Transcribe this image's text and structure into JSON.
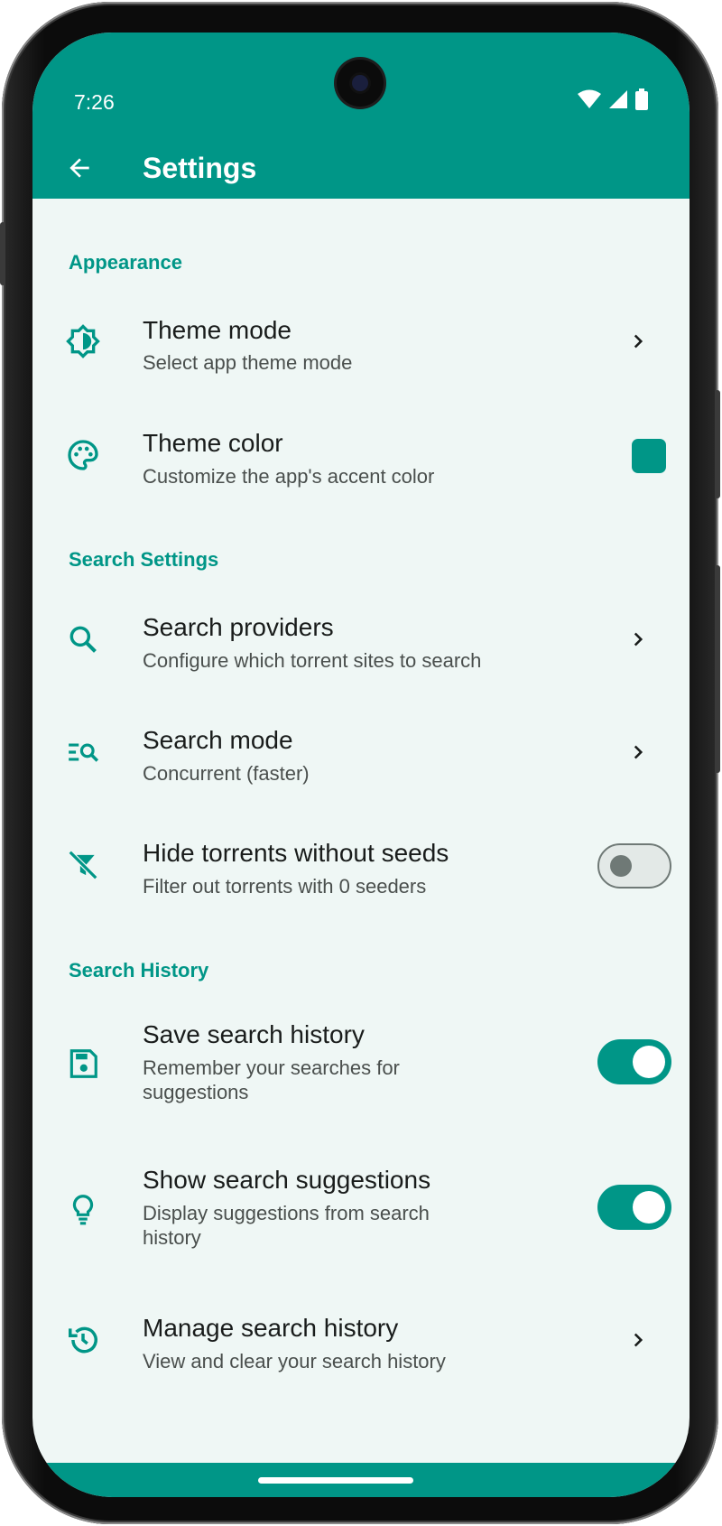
{
  "status_bar": {
    "time": "7:26"
  },
  "header": {
    "title": "Settings"
  },
  "colors": {
    "accent": "#009687",
    "background": "#eff7f5",
    "title_text": "#191c1b",
    "subtitle_text": "#4a4f4d"
  },
  "sections": {
    "appearance": {
      "label": "Appearance",
      "theme_mode": {
        "icon": "brightness-icon",
        "title": "Theme mode",
        "subtitle": "Select app theme mode"
      },
      "theme_color": {
        "icon": "palette-icon",
        "title": "Theme color",
        "subtitle": "Customize the app's accent color",
        "color": "#009687"
      }
    },
    "search_settings": {
      "label": "Search Settings",
      "providers": {
        "icon": "search-icon",
        "title": "Search providers",
        "subtitle": "Configure which torrent sites to search"
      },
      "mode": {
        "icon": "search-list-icon",
        "title": "Search mode",
        "subtitle": "Concurrent (faster)"
      },
      "hide_no_seeds": {
        "icon": "filter-off-icon",
        "title": "Hide torrents without seeds",
        "subtitle": "Filter out torrents with 0 seeders",
        "enabled": false
      }
    },
    "search_history": {
      "label": "Search History",
      "save": {
        "icon": "save-icon",
        "title": "Save search history",
        "subtitle": "Remember your searches for suggestions",
        "enabled": true
      },
      "suggestions": {
        "icon": "lightbulb-icon",
        "title": "Show search suggestions",
        "subtitle": "Display suggestions from search history",
        "enabled": true
      },
      "manage": {
        "icon": "history-icon",
        "title": "Manage search history",
        "subtitle": "View and clear your search history"
      }
    }
  }
}
